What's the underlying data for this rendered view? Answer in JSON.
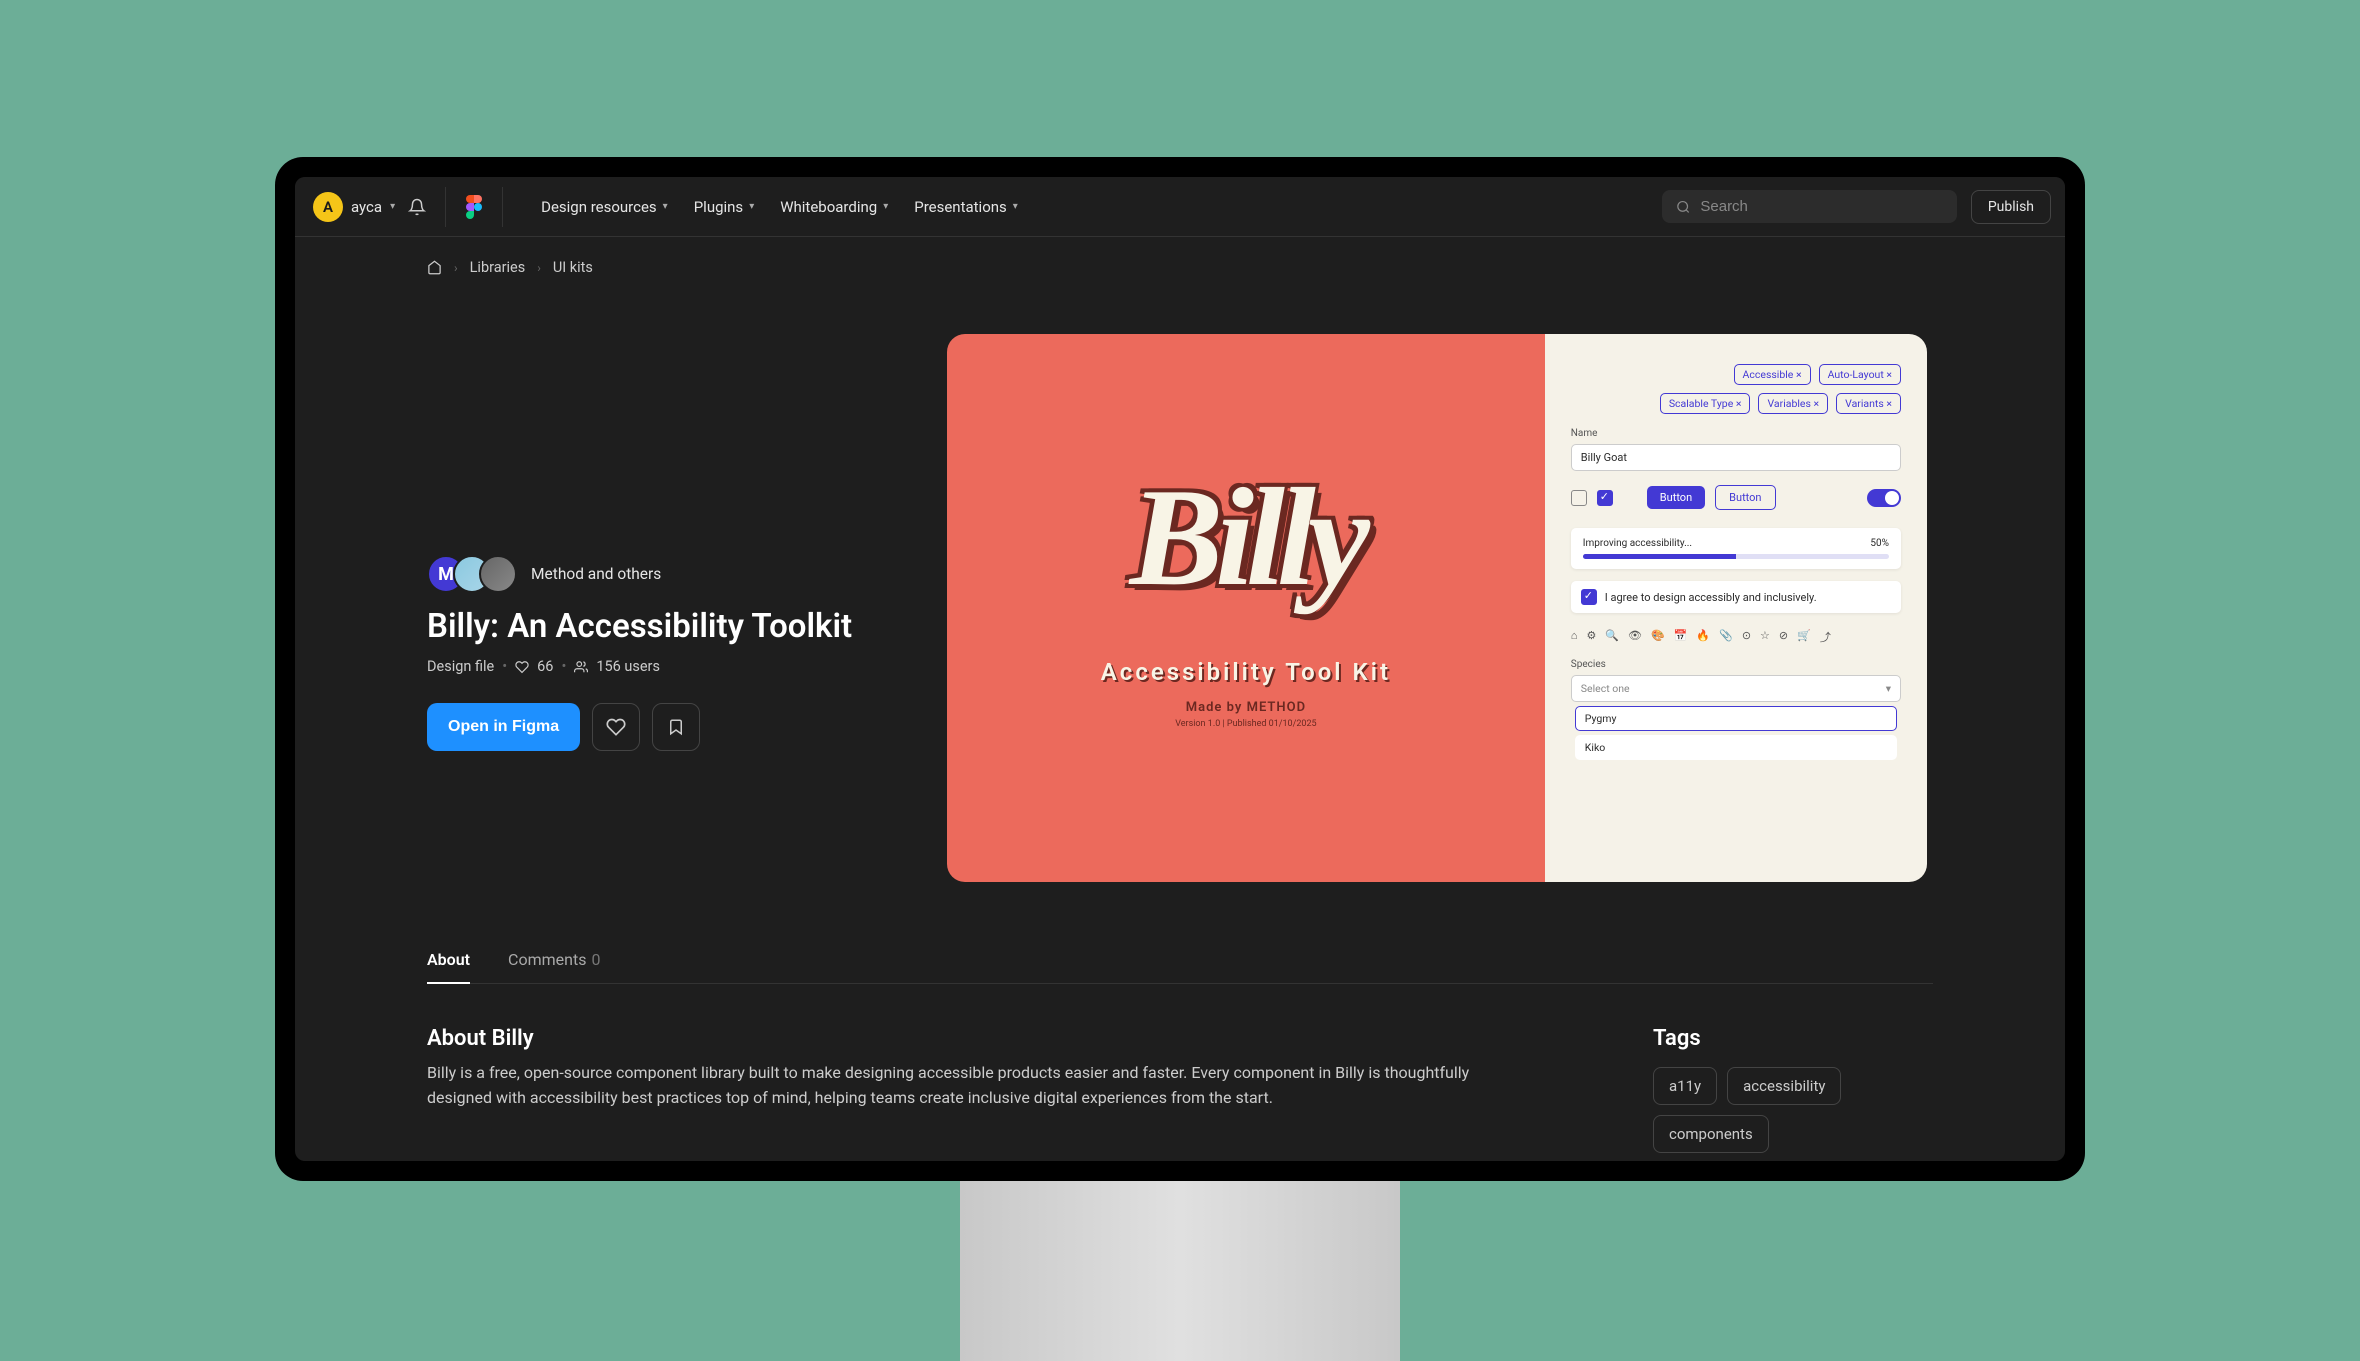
{
  "topbar": {
    "avatar_letter": "A",
    "username": "ayca",
    "nav": {
      "design_resources": "Design resources",
      "plugins": "Plugins",
      "whiteboarding": "Whiteboarding",
      "presentations": "Presentations"
    },
    "search_placeholder": "Search",
    "publish": "Publish"
  },
  "breadcrumb": {
    "libraries": "Libraries",
    "ui_kits": "UI kits"
  },
  "resource": {
    "author_initial": "M",
    "authors_label": "Method and others",
    "title": "Billy: An Accessibility Toolkit",
    "file_type": "Design file",
    "likes": "66",
    "users": "156 users",
    "open_button": "Open in Figma"
  },
  "cover": {
    "logo_text": "Billy",
    "subtitle": "Accessibility Tool Kit",
    "made_by": "Made by METHOD",
    "version": "Version 1.0 | Published 01/10/2025",
    "chips": {
      "accessible": "Accessible ×",
      "auto_layout": "Auto-Layout ×",
      "scalable_type": "Scalable Type ×",
      "variables": "Variables ×",
      "variants": "Variants ×"
    },
    "name_label": "Name",
    "name_value": "Billy Goat",
    "button_primary": "Button",
    "button_secondary": "Button",
    "progress_label": "Improving accessibility...",
    "progress_value": "50%",
    "agree_text": "I agree to design accessibly and inclusively.",
    "species_label": "Species",
    "species_placeholder": "Select one",
    "option_pygmy": "Pygmy",
    "option_kiko": "Kiko"
  },
  "tabs": {
    "about": "About",
    "comments": "Comments",
    "comments_count": "0"
  },
  "about": {
    "heading": "About Billy",
    "body": "Billy is a free, open-source component library built to make designing accessible products easier and faster. Every component in Billy is thoughtfully designed with accessibility best practices top of mind, helping teams create inclusive digital experiences from the start."
  },
  "tags": {
    "heading": "Tags",
    "items": {
      "a11y": "a11y",
      "accessibility": "accessibility",
      "components": "components"
    }
  }
}
